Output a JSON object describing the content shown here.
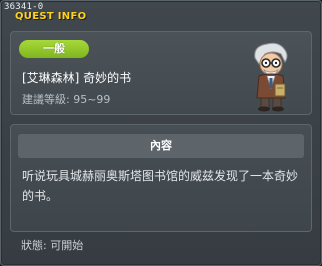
{
  "window": {
    "quest_id": "36341-0",
    "title": "QUEST INFO"
  },
  "quest": {
    "category": "一般",
    "name": "[艾琳森林] 奇妙的书",
    "recommended_level": "建議等級: 95~99"
  },
  "content": {
    "header": "內容",
    "text": "听说玩具城赫丽奥斯塔图书馆的威兹发现了一本奇妙的书。"
  },
  "status": {
    "text": "狀態: 可開始"
  },
  "colors": {
    "title": "#ffd21a",
    "badge": "#8cc82a"
  },
  "icons": {
    "npc": "old-scholar-npc-icon"
  }
}
